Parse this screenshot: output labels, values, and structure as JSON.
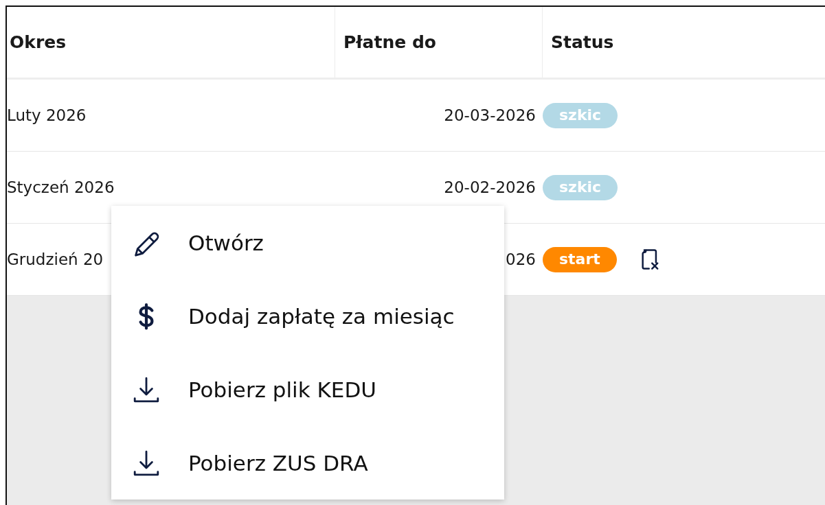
{
  "table": {
    "columns": [
      {
        "label": "Okres"
      },
      {
        "label": "Płatne do"
      },
      {
        "label": "Status"
      }
    ],
    "rows": [
      {
        "period": "Luty 2026",
        "due": "20-03-2026",
        "status": {
          "label": "szkic",
          "color": "#b3d9e6"
        },
        "kind": "plain"
      },
      {
        "period": "Styczeń 2026",
        "due": "20-02-2026",
        "status": {
          "label": "szkic",
          "color": "#b3d9e6"
        },
        "kind": "plain"
      },
      {
        "period": "Grudzień 20",
        "due": "026",
        "status": {
          "label": "start",
          "color": "#ff8800"
        },
        "kind": "file-error"
      }
    ]
  },
  "context_menu": {
    "items": [
      {
        "label": "Otwórz",
        "kind": "edit"
      },
      {
        "label": "Dodaj zapłatę za miesiąc",
        "kind": "payment"
      },
      {
        "label": "Pobierz plik KEDU",
        "kind": "download"
      },
      {
        "label": "Pobierz ZUS DRA",
        "kind": "download"
      }
    ]
  }
}
